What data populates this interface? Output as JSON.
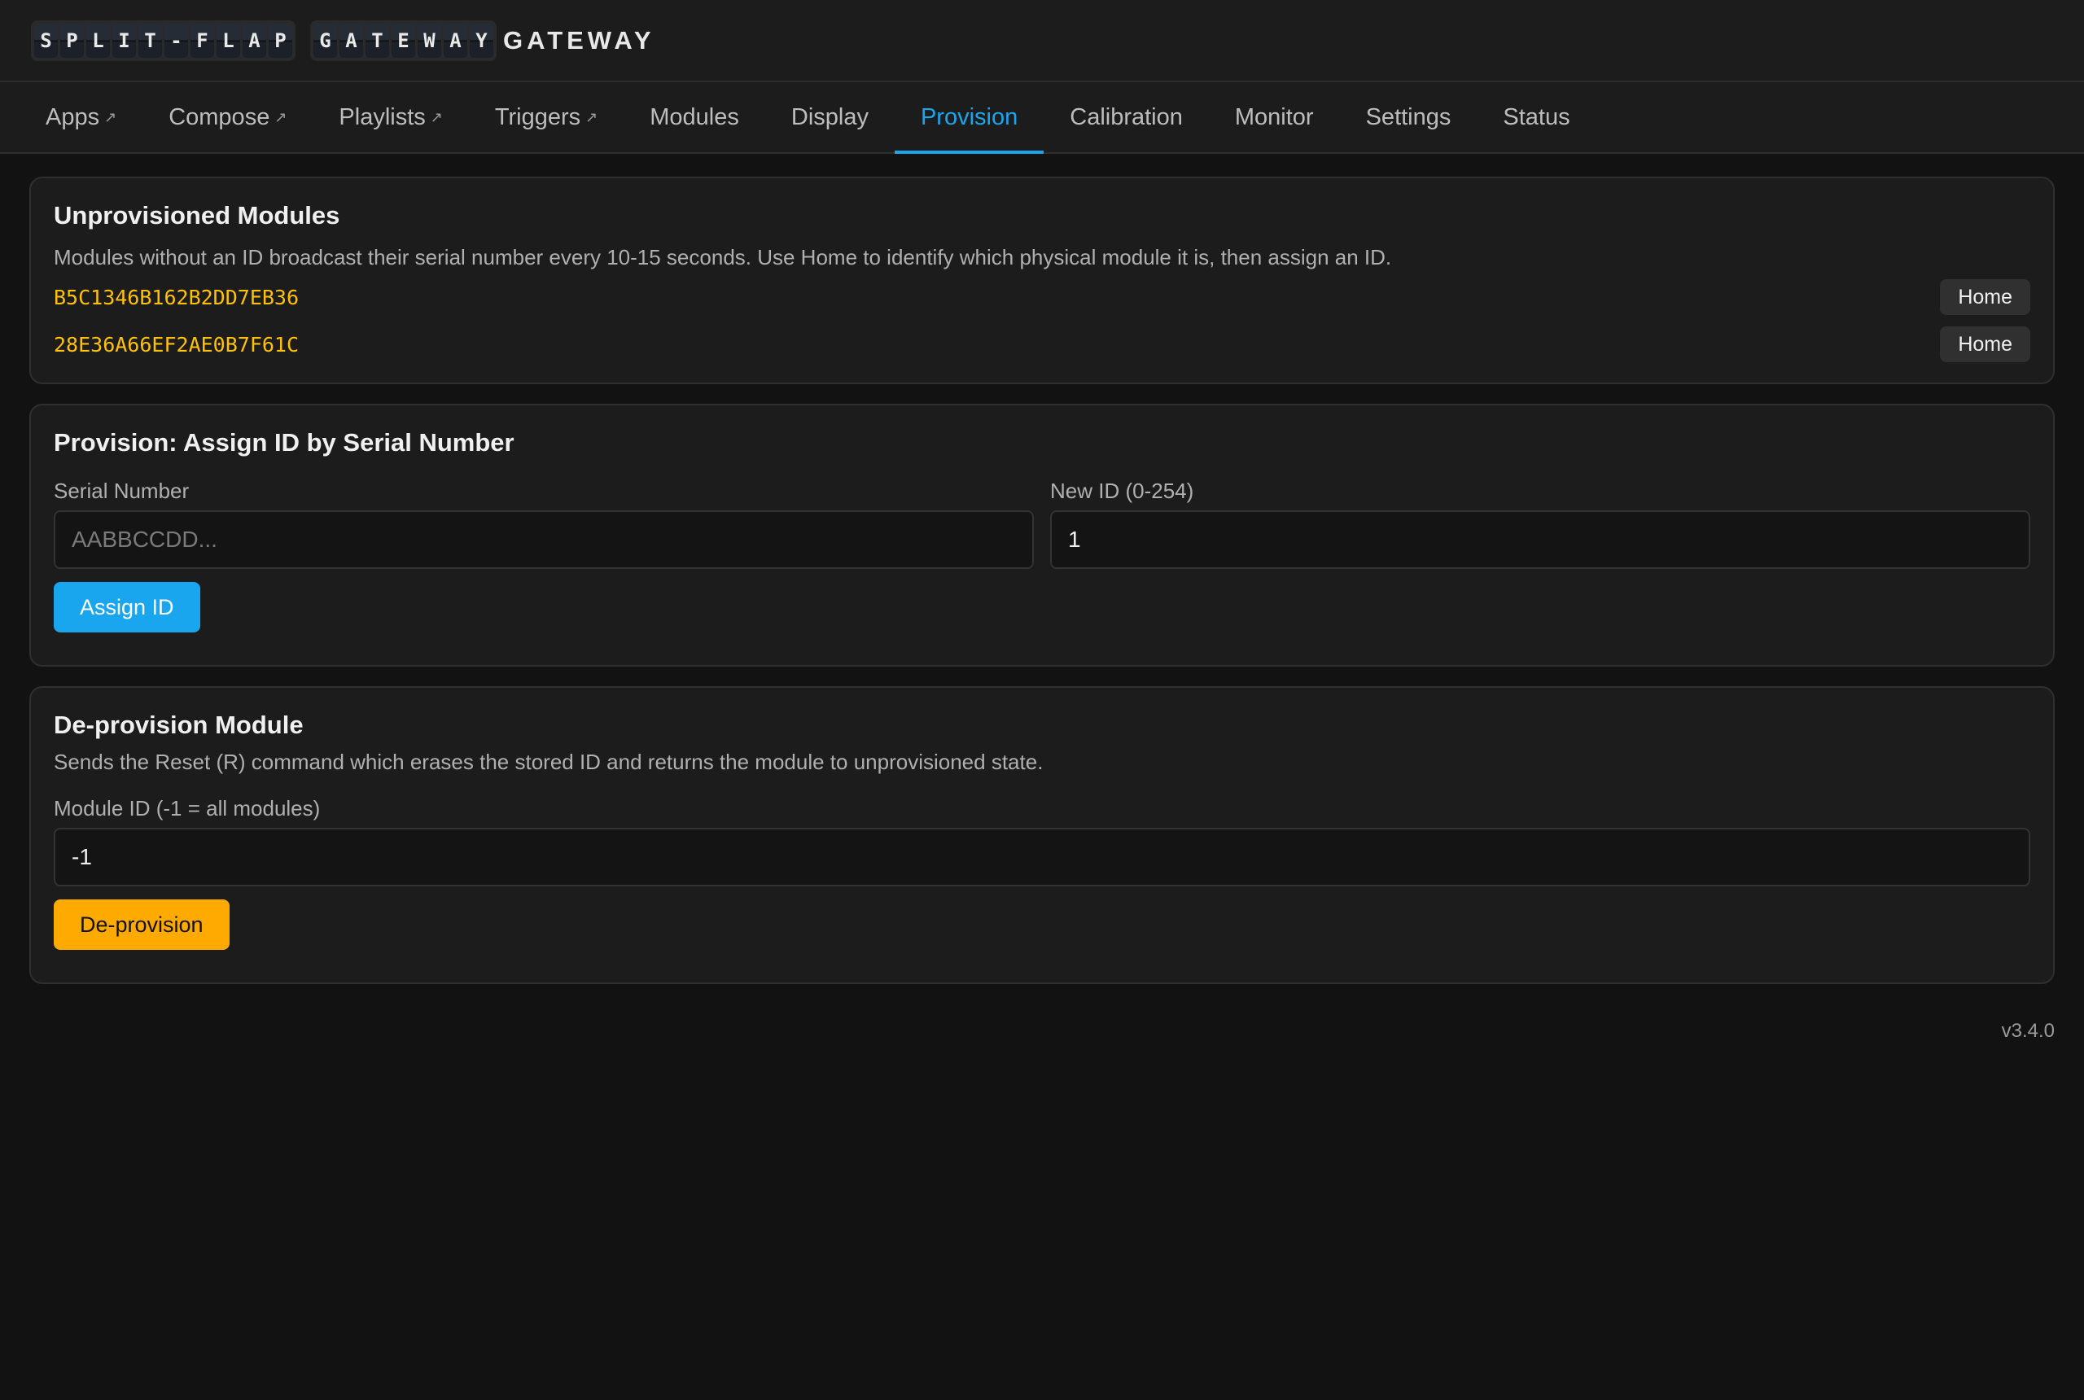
{
  "header": {
    "logo_words": [
      "SPLIT-FLAP",
      "GATEWAY"
    ],
    "brand": "GATEWAY"
  },
  "nav": {
    "tabs": [
      {
        "label": "Apps",
        "external": true
      },
      {
        "label": "Compose",
        "external": true
      },
      {
        "label": "Playlists",
        "external": true
      },
      {
        "label": "Triggers",
        "external": true
      },
      {
        "label": "Modules",
        "external": false
      },
      {
        "label": "Display",
        "external": false
      },
      {
        "label": "Provision",
        "external": false,
        "active": true
      },
      {
        "label": "Calibration",
        "external": false
      },
      {
        "label": "Monitor",
        "external": false
      },
      {
        "label": "Settings",
        "external": false
      },
      {
        "label": "Status",
        "external": false
      }
    ],
    "external_glyph": "↗"
  },
  "unprovisioned": {
    "title": "Unprovisioned Modules",
    "description": "Modules without an ID broadcast their serial number every 10-15 seconds. Use Home to identify which physical module it is, then assign an ID.",
    "modules": [
      {
        "serial": "B5C1346B162B2DD7EB36",
        "button": "Home"
      },
      {
        "serial": "28E36A66EF2AE0B7F61C",
        "button": "Home"
      }
    ]
  },
  "provision": {
    "title": "Provision: Assign ID by Serial Number",
    "serial_label": "Serial Number",
    "serial_placeholder": "AABBCCDD...",
    "serial_value": "",
    "newid_label": "New ID (0-254)",
    "newid_value": "1",
    "button": "Assign ID"
  },
  "deprovision": {
    "title": "De-provision Module",
    "description": "Sends the Reset (R) command which erases the stored ID and returns the module to unprovisioned state.",
    "module_label": "Module ID (-1 = all modules)",
    "module_value": "-1",
    "button": "De-provision"
  },
  "version": "v3.4.0",
  "colors": {
    "accent": "#1aa6ee",
    "warning": "#ffaa00",
    "serial": "#ffc107"
  }
}
